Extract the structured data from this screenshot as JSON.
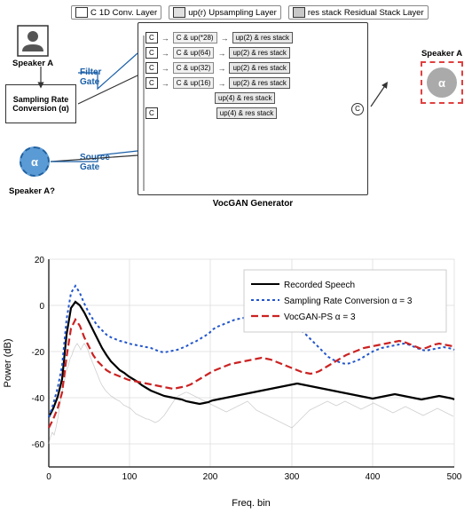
{
  "legend": {
    "items": [
      {
        "label": "C",
        "desc": "1D Conv. Layer"
      },
      {
        "label": "up(r)",
        "desc": "Upsampling Layer"
      },
      {
        "label": "res stack",
        "desc": "Residual Stack Layer"
      }
    ]
  },
  "diagram": {
    "speakerALeftLabel": "Speaker A",
    "speakerAQuestionLabel": "Speaker A?",
    "speakerARightLabel": "Speaker A",
    "srcBoxLabel": "Sampling Rate\nConversion (α)",
    "filterGateLabel": "Filter\nGate",
    "sourceGateLabel": "Source\nGate",
    "vocganTitle": "VocGAN Generator",
    "alphaSymbol": "α",
    "rows": [
      {
        "c": "C",
        "up": "C & up(*28)",
        "up2": "up(2) & res stack"
      },
      {
        "c": "C",
        "up": "C & up(64)",
        "up2": "up(2) & res stack"
      },
      {
        "c": "C",
        "up": "C & up(32)",
        "up2": "up(2) & res stack"
      },
      {
        "c": "C",
        "up": "C & up(16)",
        "up2": "up(2) & res stack"
      },
      {
        "c": "",
        "up": "",
        "up2": "up(4) & res stack"
      },
      {
        "c": "C",
        "up": "",
        "up2": "up(4) & res stack"
      }
    ]
  },
  "chart": {
    "title": "",
    "xLabel": "Freq. bin",
    "yLabel": "Power (dB)",
    "xMin": 0,
    "xMax": 500,
    "yMin": -70,
    "yMax": 20,
    "yTicks": [
      20,
      0,
      -20,
      -40,
      -60
    ],
    "xTicks": [
      0,
      100,
      200,
      300,
      400,
      500
    ],
    "legend": [
      {
        "label": "Recorded Speech",
        "style": "solid",
        "color": "#000"
      },
      {
        "label": "Sampling Rate Conversion α = 3",
        "style": "dotted",
        "color": "#2255cc"
      },
      {
        "label": "VocGAN-PS α = 3",
        "style": "dashed",
        "color": "#cc2222"
      }
    ]
  }
}
